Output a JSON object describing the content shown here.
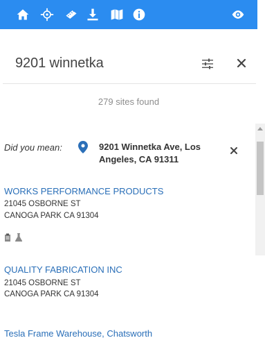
{
  "toolbar": {
    "icons": [
      "home-icon",
      "crosshair-icon",
      "ruler-icon",
      "download-icon",
      "map-icon",
      "info-icon",
      "eye-icon"
    ],
    "color": "#2b8cf0"
  },
  "search": {
    "value": "9201 winnetka"
  },
  "results": {
    "count_text": "279 sites found"
  },
  "did_you_mean": {
    "label": "Did you mean:",
    "address_line1": "9201 Winnetka Ave, Los",
    "address_line2": "Angeles, CA 91311"
  },
  "sites": [
    {
      "name": "WORKS PERFORMANCE PRODUCTS",
      "street": "21045 OSBORNE ST",
      "city": "CANOGA PARK CA 91304",
      "icons": [
        "clipboard-icon",
        "flask-icon"
      ]
    },
    {
      "name": "QUALITY FABRICATION INC",
      "street": "21045 OSBORNE ST",
      "city": "CANOGA PARK CA 91304",
      "icons": []
    }
  ],
  "truncated_next": "Tesla Frame Warehouse, Chatsworth",
  "link_color": "#2a6fb8"
}
